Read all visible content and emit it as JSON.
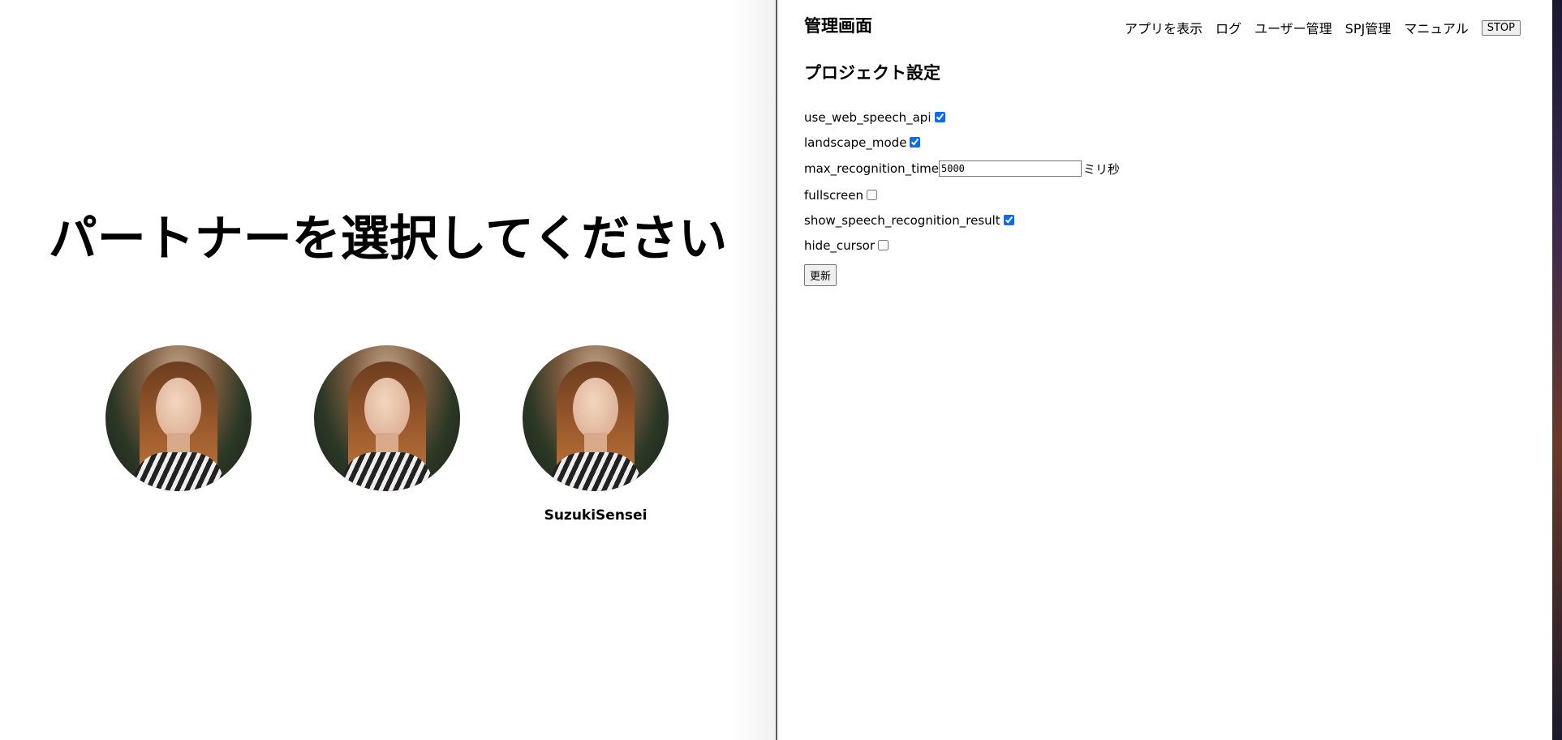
{
  "partner_select": {
    "title": "パートナーを選択してください",
    "partners": [
      {
        "name": ""
      },
      {
        "name": ""
      },
      {
        "name": "SuzukiSensei"
      }
    ]
  },
  "admin": {
    "title": "管理画面",
    "nav": {
      "show_app": "アプリを表示",
      "log": "ログ",
      "user_management": "ユーザー管理",
      "spj_management": "SPJ管理",
      "manual": "マニュアル",
      "stop": "STOP"
    },
    "section_title": "プロジェクト設定",
    "settings": {
      "use_web_speech_api": {
        "label": "use_web_speech_api",
        "checked": true
      },
      "landscape_mode": {
        "label": "landscape_mode",
        "checked": true
      },
      "max_recognition_time": {
        "label": "max_recognition_time",
        "value": "5000",
        "unit": "ミリ秒"
      },
      "fullscreen": {
        "label": "fullscreen",
        "checked": false
      },
      "show_speech_recognition_result": {
        "label": "show_speech_recognition_result",
        "checked": true
      },
      "hide_cursor": {
        "label": "hide_cursor",
        "checked": false
      }
    },
    "update_button": "更新"
  },
  "colors": {
    "checkbox_accent": "#0b6bf0",
    "divider": "#5a5a5a"
  }
}
